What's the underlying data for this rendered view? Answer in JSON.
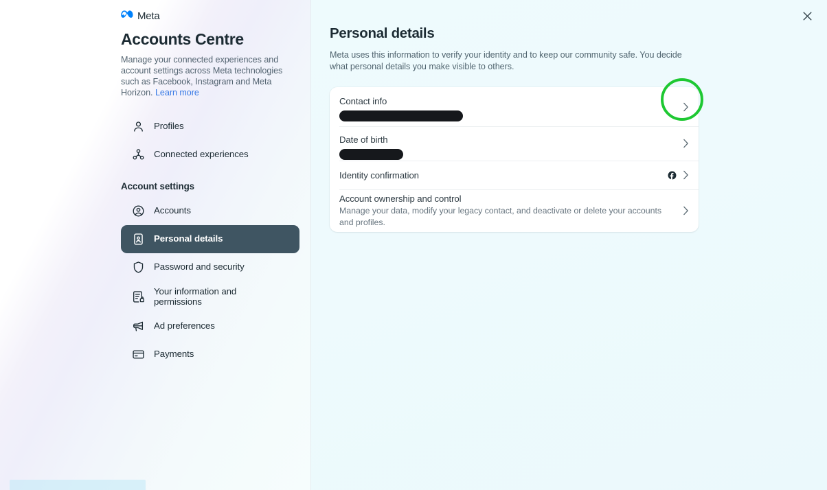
{
  "window": {
    "close_label": "×"
  },
  "sidebar": {
    "brand": "Meta",
    "brand_logo": "meta-infinity-logo",
    "title": "Accounts Centre",
    "description": "Manage your connected experiences and account settings across Meta technologies such as Facebook, Instagram and Meta Horizon. ",
    "learn_more": "Learn more",
    "items": [
      {
        "label": "Profiles",
        "icon": "person-icon",
        "active": false
      },
      {
        "label": "Connected experiences",
        "icon": "network-nodes-icon",
        "active": false
      }
    ],
    "section_heading": "Account settings",
    "settings_items": [
      {
        "label": "Accounts",
        "icon": "account-circle-icon",
        "active": false
      },
      {
        "label": "Personal details",
        "icon": "id-card-icon",
        "active": true
      },
      {
        "label": "Password and security",
        "icon": "shield-icon",
        "active": false
      },
      {
        "label": "Your information and permissions",
        "icon": "document-lock-icon",
        "active": false
      },
      {
        "label": "Ad preferences",
        "icon": "megaphone-icon",
        "active": false
      },
      {
        "label": "Payments",
        "icon": "credit-card-icon",
        "active": false
      }
    ]
  },
  "main": {
    "title": "Personal details",
    "description": "Meta uses this information to verify your identity and to keep our community safe. You decide what personal details you make visible to others.",
    "rows": [
      {
        "label": "Contact info",
        "value_redacted": true,
        "redact_width": 180,
        "chevron": "chevron-right-icon",
        "highlighted": true
      },
      {
        "label": "Date of birth",
        "value_redacted": true,
        "redact_width": 93,
        "chevron": "chevron-right-icon",
        "highlighted": false
      },
      {
        "label": "Identity confirmation",
        "badge_icon": "facebook-icon",
        "chevron": "chevron-right-icon",
        "highlighted": false
      },
      {
        "label": "Account ownership and control",
        "sub": "Manage your data, modify your legacy contact, and deactivate or delete your accounts and profiles.",
        "chevron": "chevron-right-icon",
        "highlighted": false
      }
    ]
  },
  "annotation": {
    "type": "circle-highlight",
    "color": "#1ec832",
    "target": "contact-info-chevron"
  },
  "status_strip": {
    "text": ""
  },
  "colors": {
    "accent_link": "#3578e5",
    "active_nav_bg": "#3f5562",
    "text_primary": "#1c2b33",
    "text_secondary": "#536471",
    "content_bg": "#eefbfd",
    "card_bg": "#ffffff",
    "redaction": "#16181c",
    "annotation_green": "#1ec832"
  }
}
